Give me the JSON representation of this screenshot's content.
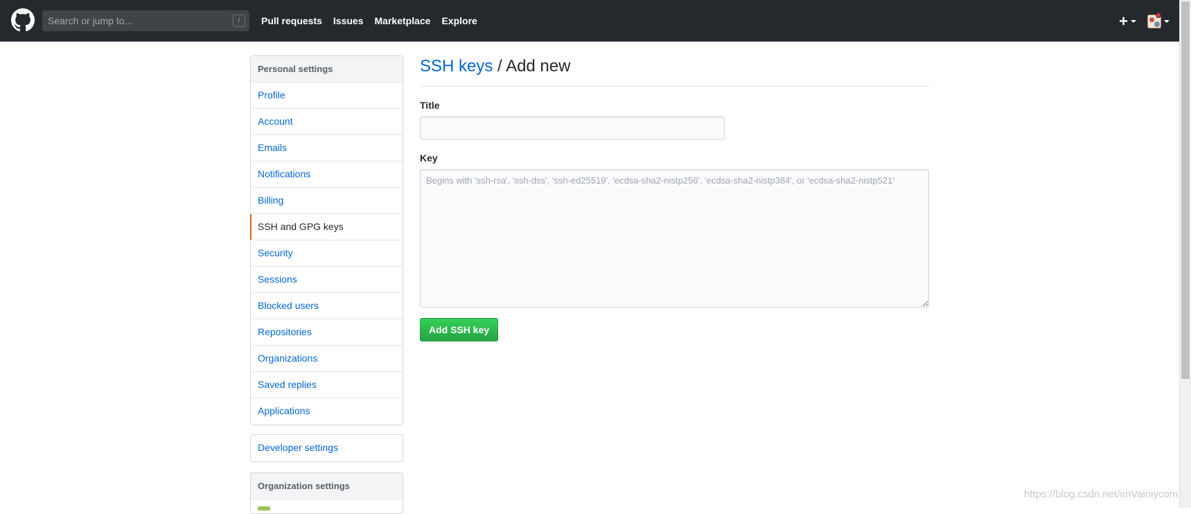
{
  "header": {
    "search_placeholder": "Search or jump to...",
    "search_shortcut": "/",
    "nav": [
      "Pull requests",
      "Issues",
      "Marketplace",
      "Explore"
    ],
    "plus_label": "+"
  },
  "sidebar": {
    "personal_heading": "Personal settings",
    "items": [
      {
        "label": "Profile"
      },
      {
        "label": "Account"
      },
      {
        "label": "Emails"
      },
      {
        "label": "Notifications"
      },
      {
        "label": "Billing"
      },
      {
        "label": "SSH and GPG keys",
        "selected": true
      },
      {
        "label": "Security"
      },
      {
        "label": "Sessions"
      },
      {
        "label": "Blocked users"
      },
      {
        "label": "Repositories"
      },
      {
        "label": "Organizations"
      },
      {
        "label": "Saved replies"
      },
      {
        "label": "Applications"
      }
    ],
    "developer_settings": "Developer settings",
    "org_heading": "Organization settings"
  },
  "main": {
    "breadcrumb_link": "SSH keys",
    "breadcrumb_sep": " / ",
    "breadcrumb_current": "Add new",
    "title_label": "Title",
    "title_value": "",
    "key_label": "Key",
    "key_placeholder": "Begins with 'ssh-rsa', 'ssh-dss', 'ssh-ed25519', 'ecdsa-sha2-nistp256', 'ecdsa-sha2-nistp384', or 'ecdsa-sha2-nistp521'",
    "submit_label": "Add SSH key"
  },
  "watermark": "https://blog.csdn.net/imVainiycom",
  "colors": {
    "header_bg": "#24292e",
    "link": "#0366d6",
    "selected_indicator": "#e36209",
    "button_green": "#28a745"
  }
}
